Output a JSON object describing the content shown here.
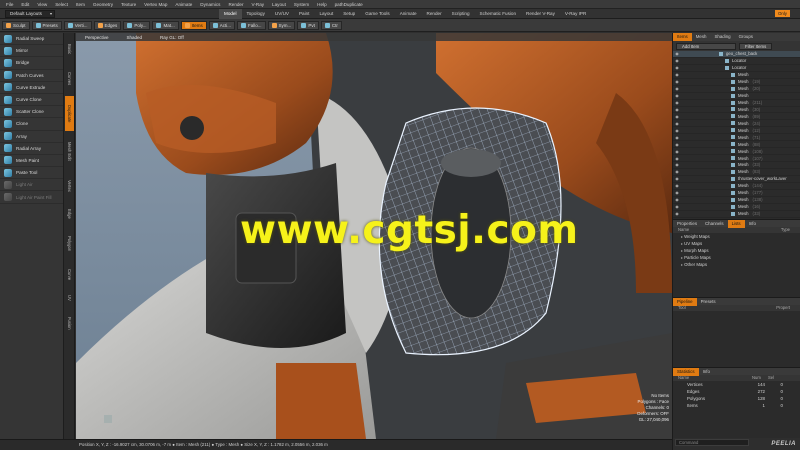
{
  "menu": [
    "File",
    "Edit",
    "View",
    "Select",
    "Item",
    "Geometry",
    "Texture",
    "Vertex Map",
    "Animate",
    "Dynamics",
    "Render",
    "V-Ray",
    "Layout",
    "System",
    "Help",
    "pathDuplicate"
  ],
  "layout": {
    "dropdown": "Default Layouts",
    "tabs": [
      "Model",
      "Topology",
      "UV/UV",
      "Paint",
      "Layout",
      "Setup",
      "Game Tools",
      "Animate",
      "Render",
      "Scripting",
      "Schematic Fusion",
      "Render V-Ray",
      "V-Ray IPR"
    ],
    "active_tab": "Model",
    "only_tag": "Only"
  },
  "toolbar": [
    "Sculpt",
    "Presets",
    "Verti...",
    "Edges",
    "Poly...",
    "Mat...",
    "Items",
    "Acti...",
    "Fallo...",
    "Sym...",
    "Pvt",
    "Ctr"
  ],
  "left_tools": [
    {
      "label": "Radial Sweep",
      "dim": false
    },
    {
      "label": "Mirror",
      "dim": false
    },
    {
      "label": "Bridge",
      "dim": false
    },
    {
      "label": "Patch Curves",
      "dim": false
    },
    {
      "label": "Curve Extrude",
      "dim": false
    },
    {
      "label": "Curve Clone",
      "dim": false
    },
    {
      "label": "Scatter Clone",
      "dim": false
    },
    {
      "label": "Clone",
      "dim": false
    },
    {
      "label": "Array",
      "dim": false
    },
    {
      "label": "Radial Array",
      "dim": false
    },
    {
      "label": "Mesh Paint",
      "dim": false
    },
    {
      "label": "Paste Tool",
      "dim": false
    },
    {
      "label": "Light Air",
      "dim": true
    },
    {
      "label": "Light Air Paint Fill",
      "dim": true
    }
  ],
  "left_vtabs": [
    "Basic",
    "Curves",
    "Duplicate",
    "Mesh Edit",
    "Vertex",
    "Edge",
    "Polygon",
    "Curve",
    "UV",
    "Fusion"
  ],
  "viewport": {
    "header": [
      "Perspective",
      "Shaded",
      "Ray GL: Off"
    ],
    "watermark": "www.cgtsj.com",
    "stats": [
      "No Items",
      "Polygons : Face",
      "Channels: 0",
      "Deformers: OFF",
      "GL: 27,040,096"
    ]
  },
  "status_bar": "Position X, Y, Z : -16.9027 cm, 30.0706 m, -7 m ● Item : Mesh (211) ● Type : Mesh ● Size X, Y, Z : 1.1782 m, 2.0556 m, 2.036 m",
  "right_panel": {
    "tabs": [
      "Items",
      "Mesh",
      "Shading",
      "Groups"
    ],
    "active_tab": "Items",
    "add_item": "Add Item",
    "filter": "Filter Items",
    "items": [
      {
        "label": "geo_chest_back",
        "count": "",
        "sel": true
      },
      {
        "label": "Locator",
        "count": "",
        "sel": false
      },
      {
        "label": "Locator",
        "count": "",
        "sel": false
      },
      {
        "label": "Mesh",
        "count": "",
        "sel": false
      },
      {
        "label": "Mesh",
        "count": "(19)",
        "sel": false
      },
      {
        "label": "Mesh",
        "count": "(20)",
        "sel": false
      },
      {
        "label": "Mesh",
        "count": "",
        "sel": false
      },
      {
        "label": "Mesh",
        "count": "(211)",
        "sel": false
      },
      {
        "label": "Mesh",
        "count": "(30)",
        "sel": false
      },
      {
        "label": "Mesh",
        "count": "(89)",
        "sel": false
      },
      {
        "label": "Mesh",
        "count": "(24)",
        "sel": false
      },
      {
        "label": "Mesh",
        "count": "(12)",
        "sel": false
      },
      {
        "label": "Mesh",
        "count": "(71)",
        "sel": false
      },
      {
        "label": "Mesh",
        "count": "(88)",
        "sel": false
      },
      {
        "label": "Mesh",
        "count": "(108)",
        "sel": false
      },
      {
        "label": "Mesh",
        "count": "(107)",
        "sel": false
      },
      {
        "label": "Mesh",
        "count": "(33)",
        "sel": false
      },
      {
        "label": "Mesh",
        "count": "(83)",
        "sel": false
      },
      {
        "label": "thruster-cover_workLaver",
        "count": "",
        "sel": false
      },
      {
        "label": "Mesh",
        "count": "(144)",
        "sel": false
      },
      {
        "label": "Mesh",
        "count": "(177)",
        "sel": false
      },
      {
        "label": "Mesh",
        "count": "(138)",
        "sel": false
      },
      {
        "label": "Mesh",
        "count": "(16)",
        "sel": false
      },
      {
        "label": "Mesh",
        "count": "(33)",
        "sel": false
      }
    ],
    "maps_tabs": [
      "Properties",
      "Channels",
      "Lists",
      "Info"
    ],
    "maps_active": "Lists",
    "maps_cols": [
      "Name",
      "Type"
    ],
    "maps": [
      "Weight Maps",
      "UV Maps",
      "Morph Maps",
      "Particle Maps",
      "Other Maps"
    ],
    "pipeline_tabs": [
      "Pipeline",
      "Presets"
    ],
    "pipeline_cols": [
      "Tool",
      "Propert"
    ],
    "stats_tabs": [
      "Statistics",
      "Info"
    ],
    "stats_cols": [
      "Name",
      "Num",
      "Sel"
    ],
    "stats": [
      {
        "name": "Vertices",
        "num": "144",
        "sel": "0"
      },
      {
        "name": "Edges",
        "num": "272",
        "sel": "0"
      },
      {
        "name": "Polygons",
        "num": "128",
        "sel": "0"
      },
      {
        "name": "Items",
        "num": "1",
        "sel": "0"
      }
    ],
    "command": "Command",
    "logo": "PEELIA"
  }
}
